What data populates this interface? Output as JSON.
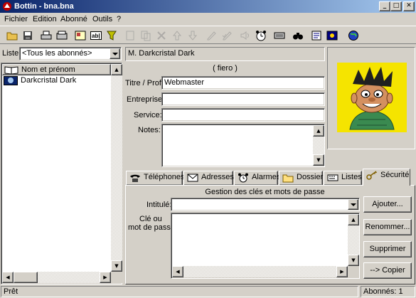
{
  "window": {
    "title": "Bottin - bna.bna",
    "minimize_glyph": "_",
    "maximize_glyph": "□",
    "close_glyph": "✕"
  },
  "menu": [
    {
      "label": "Fichier"
    },
    {
      "label": "Edition"
    },
    {
      "label": "Abonné"
    },
    {
      "label": "Outils"
    },
    {
      "label": "?"
    }
  ],
  "toolbar": {
    "buttons": [
      {
        "icon": "open-folder-icon",
        "enabled": true
      },
      {
        "icon": "save-icon",
        "enabled": true
      },
      {
        "icon": "print-icon",
        "enabled": true
      },
      {
        "icon": "print-preview-icon",
        "enabled": true
      },
      {
        "icon": "card-icon",
        "enabled": true
      },
      {
        "icon": "text-field-icon",
        "enabled": true
      },
      {
        "icon": "filter-icon",
        "enabled": true
      },
      {
        "icon": "new-icon",
        "enabled": false
      },
      {
        "icon": "copy-icon",
        "enabled": false
      },
      {
        "icon": "delete-icon",
        "enabled": false
      },
      {
        "icon": "up-arrow-icon",
        "enabled": false
      },
      {
        "icon": "down-arrow-icon",
        "enabled": false
      },
      {
        "icon": "edit-icon",
        "enabled": false
      },
      {
        "icon": "edit-check-icon",
        "enabled": false
      },
      {
        "icon": "sound-icon",
        "enabled": false
      },
      {
        "icon": "clock-icon",
        "enabled": true
      },
      {
        "icon": "keyboard-icon",
        "enabled": true
      },
      {
        "icon": "binoculars-icon",
        "enabled": true
      },
      {
        "icon": "notes-icon",
        "enabled": true
      },
      {
        "icon": "photo-icon",
        "enabled": true
      },
      {
        "icon": "globe-icon",
        "enabled": true
      }
    ]
  },
  "list": {
    "label": "Liste:",
    "selected": "<Tous les abonnés>",
    "column_header": "Nom et prénom",
    "rows": [
      "Darkcristal Dark"
    ]
  },
  "record": {
    "name": "M. Darkcristal Dark",
    "nickname": "( fiero )",
    "fields": {
      "title_label": "Titre / Prof:",
      "title_value": "Webmaster",
      "company_label": "Entreprise:",
      "company_value": "",
      "service_label": "Service:",
      "service_value": "",
      "notes_label": "Notes:",
      "notes_value": ""
    }
  },
  "tabs": [
    {
      "label": "Téléphones",
      "icon": "phone-icon",
      "active": false
    },
    {
      "label": "Adresses",
      "icon": "envelope-icon",
      "active": false
    },
    {
      "label": "Alarmes",
      "icon": "alarm-clock-icon",
      "active": false
    },
    {
      "label": "Dossier",
      "icon": "folder-icon",
      "active": false
    },
    {
      "label": "Listes",
      "icon": "list-icon",
      "active": false
    },
    {
      "label": "Sécurité",
      "icon": "key-icon",
      "active": true
    }
  ],
  "security": {
    "heading": "Gestion des clés et mots de passe",
    "intitule_label": "Intitulé:",
    "intitule_value": "",
    "password_label_1": "Clé ou",
    "password_label_2": "mot de passe:",
    "buttons": {
      "add": "Ajouter...",
      "rename": "Renommer...",
      "delete": "Supprimer",
      "copy": "--> Copier"
    }
  },
  "status": {
    "left": "Prêt",
    "right": "Abonnés: 1"
  },
  "colors": {
    "title_start": "#0a246a",
    "title_end": "#a6caf0",
    "face": "#d4d0c8",
    "photo_bg": "#f5e400"
  }
}
